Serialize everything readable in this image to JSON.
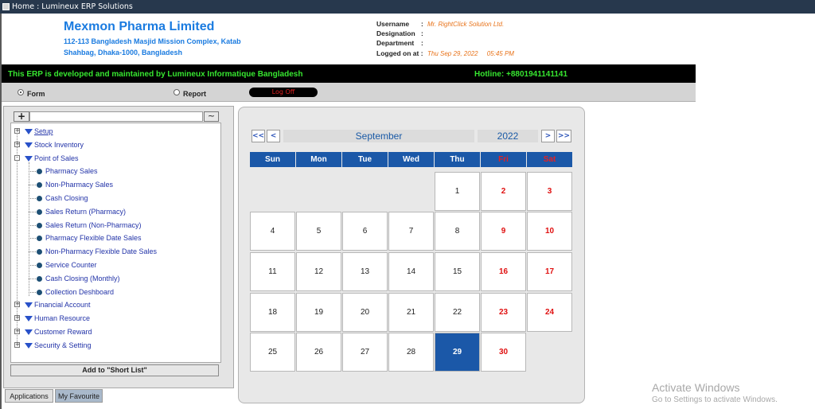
{
  "window": {
    "title": "Home : Lumineux ERP Solutions"
  },
  "header": {
    "company": "Mexmon Pharma Limited",
    "address_line1": "112-113 Bangladesh Masjid Mission Complex, Katab",
    "address_line2": "Shahbag, Dhaka-1000, Bangladesh",
    "labels": {
      "username": "Username",
      "designation": "Designation",
      "department": "Department",
      "logged_on": "Logged on at :"
    },
    "username_value": "Mr. RightClick Solution Ltd.",
    "logged_on_value": "Thu Sep 29, 2022     05:45 PM"
  },
  "banner": {
    "left": "This ERP is developed and maintained by Lumineux Informatique Bangladesh",
    "right": "Hotline: +8801941141141"
  },
  "toolbar": {
    "form_label": "Form",
    "report_label": "Report",
    "logoff_label": "Log Off",
    "selected": "Form"
  },
  "tree": {
    "plus_label": "+",
    "tilde_label": "~",
    "nodes": [
      {
        "label": "Setup",
        "type": "folder"
      },
      {
        "label": "Stock Inventory",
        "type": "folder"
      },
      {
        "label": "Point of Sales",
        "type": "folder-open"
      },
      {
        "label": "Pharmacy Sales",
        "type": "leaf"
      },
      {
        "label": "Non-Pharmacy Sales",
        "type": "leaf"
      },
      {
        "label": "Cash Closing",
        "type": "leaf"
      },
      {
        "label": "Sales Return (Pharmacy)",
        "type": "leaf"
      },
      {
        "label": "Sales Return (Non-Pharmacy)",
        "type": "leaf"
      },
      {
        "label": "Pharmacy Flexible Date Sales",
        "type": "leaf"
      },
      {
        "label": "Non-Pharmacy Flexible Date Sales",
        "type": "leaf"
      },
      {
        "label": "Service Counter",
        "type": "leaf"
      },
      {
        "label": "Cash Closing (Monthly)",
        "type": "leaf"
      },
      {
        "label": "Collection Deshboard",
        "type": "leaf"
      },
      {
        "label": "Financial Account",
        "type": "folder"
      },
      {
        "label": "Human Resource",
        "type": "folder"
      },
      {
        "label": "Customer Reward",
        "type": "folder"
      },
      {
        "label": "Security & Setting",
        "type": "folder"
      }
    ],
    "add_button": "Add to \"Short List\""
  },
  "tabs": {
    "applications": "Applications",
    "favourite": "My Favourite"
  },
  "calendar": {
    "nav": {
      "first": "<<",
      "prev": "<",
      "next": ">",
      "last": ">>"
    },
    "month": "September",
    "year": "2022",
    "weekdays": [
      "Sun",
      "Mon",
      "Tue",
      "Wed",
      "Thu",
      "Fri",
      "Sat"
    ],
    "first_weekday_index": 4,
    "days_in_month": 30,
    "selected_day": 29,
    "weekend_color": "#e01010",
    "accent_color": "#1b58a8"
  },
  "watermark": {
    "line1": "Activate Windows",
    "line2": "Go to Settings to activate Windows."
  }
}
